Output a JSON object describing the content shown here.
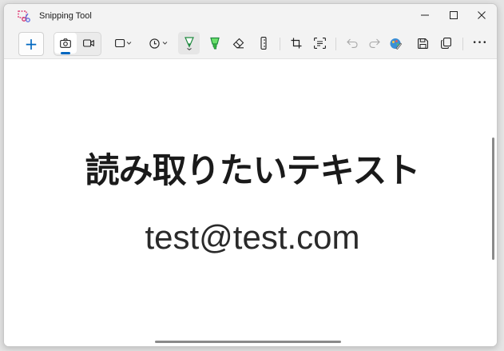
{
  "window": {
    "title": "Snipping Tool",
    "app_icon": "snipping-tool-icon"
  },
  "title_controls": {
    "minimize_icon": "minimize-icon",
    "maximize_icon": "maximize-icon",
    "close_icon": "close-icon"
  },
  "toolbar": {
    "new": {
      "symbol": "+",
      "icon": "plus-icon"
    },
    "modes": [
      {
        "name": "screenshot-mode",
        "icon": "camera-icon",
        "active": true
      },
      {
        "name": "video-mode",
        "icon": "video-camera-icon",
        "active": false
      }
    ],
    "snip_shape": {
      "icon": "rectangle-snip-icon"
    },
    "delay": {
      "icon": "clock-icon"
    },
    "tools": [
      {
        "name": "ballpoint-pen",
        "icon": "pen-icon",
        "color": "#1f8a3f",
        "selected": true
      },
      {
        "name": "highlighter",
        "icon": "highlighter-icon",
        "color": "#3fc23f"
      },
      {
        "name": "eraser",
        "icon": "eraser-icon"
      },
      {
        "name": "ruler",
        "icon": "ruler-icon"
      },
      {
        "name": "crop",
        "icon": "crop-icon"
      },
      {
        "name": "text-actions",
        "icon": "text-actions-icon"
      },
      {
        "name": "undo",
        "icon": "undo-icon",
        "enabled": false
      },
      {
        "name": "redo",
        "icon": "redo-icon",
        "enabled": false
      },
      {
        "name": "edit-in-paint",
        "icon": "paint-icon"
      },
      {
        "name": "save",
        "icon": "save-icon"
      },
      {
        "name": "copy",
        "icon": "copy-icon"
      },
      {
        "name": "more",
        "icon": "more-icon",
        "symbol": "•••"
      }
    ]
  },
  "screenshot": {
    "heading": "読み取りたいテキスト",
    "email": "test@test.com"
  },
  "colors": {
    "accent": "#0067c0",
    "pen_green": "#1f8a3f",
    "highlighter_green": "#3fc23f"
  }
}
